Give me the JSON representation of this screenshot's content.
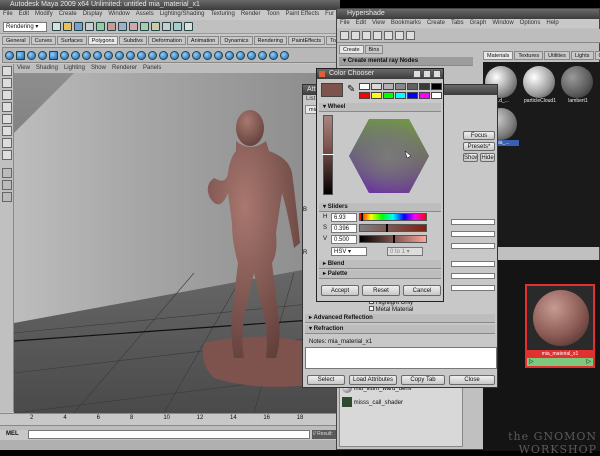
{
  "maya": {
    "title": "Autodesk Maya 2009 x64  Unlimited: untitled    mia_material_x1",
    "menu": [
      "File",
      "Edit",
      "Modify",
      "Create",
      "Display",
      "Window",
      "Assets",
      "Lighting/Shading",
      "Texturing",
      "Render",
      "Toon",
      "Paint Effects",
      "Fur",
      "Muscle",
      "Hair",
      "nCloth",
      "Help"
    ],
    "menuset": "Rendering",
    "shelf_tabs": [
      "General",
      "Curves",
      "Surfaces",
      "Polygons",
      "Subdivs",
      "Deformation",
      "Animation",
      "Dynamics",
      "Rendering",
      "PaintEffects",
      "Toon",
      "Fluids",
      "Fur"
    ],
    "shelf_active": "Polygons",
    "panel_menu": [
      "View",
      "Shading",
      "Lighting",
      "Show",
      "Renderer",
      "Panels"
    ],
    "ruler_ticks": [
      "2",
      "4",
      "6",
      "8",
      "10",
      "12",
      "14",
      "16",
      "18"
    ],
    "command_label": "MEL",
    "result_text": "// Result:"
  },
  "hypershade": {
    "title": "Hypershade",
    "menu": [
      "File",
      "Edit",
      "View",
      "Bookmarks",
      "Create",
      "Tabs",
      "Graph",
      "Window",
      "Options",
      "Help"
    ],
    "create_tab": "Create",
    "bins_tab": "Bins",
    "create_header": "Create mental ray Nodes",
    "top_tabs": [
      "Materials",
      "Textures",
      "Utilities",
      "Lights",
      "Cameras"
    ],
    "materials": [
      {
        "label": "...d_..."
      },
      {
        "label": "particleCloud1"
      },
      {
        "label": "lambert1"
      },
      {
        "label": "mia_..."
      }
    ],
    "work_tab": "ea",
    "selected_node": "mia_material_x1"
  },
  "attribute_editor": {
    "title": "Attr...",
    "menu": [
      "List",
      "Sel..."
    ],
    "tab": "mia_mat...",
    "focus_button": "Focus",
    "presets_button": "Presets*",
    "show_button": "Show",
    "hide_button": "Hide",
    "sections": [
      "Advanced Reflection",
      "Refraction"
    ],
    "checkbox_labels": [
      "Highlight Only",
      "Metal Material"
    ],
    "notes_label": "Notes:  mia_material_x1",
    "select_button": "Select",
    "load_button": "Load Attributes",
    "copy_button": "Copy Tab",
    "close_button": "Close"
  },
  "color_chooser": {
    "title": "Color Chooser",
    "wheel_section": "Wheel",
    "sliders_section": "Sliders",
    "h_label": "H",
    "h_value": "6.93",
    "s_label": "S",
    "s_value": "0.396",
    "v_label": "V",
    "v_value": "0.500",
    "mode": "HSV",
    "range": "0 to 1",
    "blend_section": "Blend",
    "palette_section": "Palette",
    "accept_button": "Accept",
    "reset_button": "Reset",
    "cancel_button": "Cancel",
    "current_color": "#7e524d",
    "palette_colors": [
      "#ffffff",
      "#d8d8d8",
      "#b0b0b0",
      "#888888",
      "#606060",
      "#383838",
      "#000000",
      "#ff0000",
      "#ffff00",
      "#00ff00",
      "#00ffff",
      "#0000ff",
      "#ff00ff",
      "#ffffff"
    ]
  },
  "node_list": {
    "items": [
      "mib_illum_ward_deriv",
      "misss_call_shader"
    ]
  },
  "watermark": "the GNOMON WORKSHOP",
  "colors": {
    "viewport_bg": "#9a9a9a",
    "figure": "#8c625c",
    "maya_gray": "#c8c8c8",
    "hypershade_dark": "#1a1a1a",
    "selection_red": "#e03030"
  }
}
